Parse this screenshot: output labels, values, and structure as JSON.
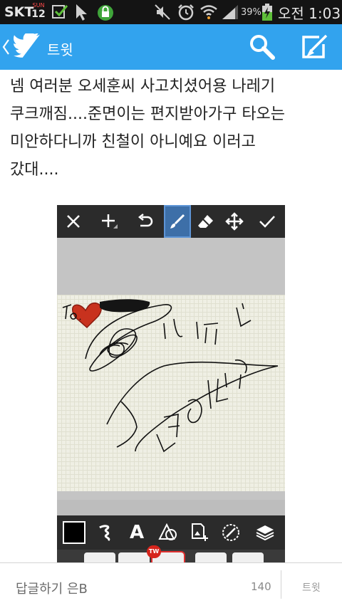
{
  "status_bar": {
    "carrier": "SKT",
    "calendar_day": "SUN",
    "calendar_date": "12",
    "battery_percent": "39%",
    "time": "오전 1:03"
  },
  "app_bar": {
    "title": "트윗",
    "color": "#32a3ee"
  },
  "tweet": {
    "lines": [
      "넴 여러분 오세훈씨 사고치셨어용 나레기",
      "쿠크깨짐....준면이는 편지받아가구 타오는",
      "미안하다니까 친철이 아니예요 이러고",
      "갔대...."
    ]
  },
  "photo": {
    "handwriting": "To. 세훈 김준면",
    "badge": "TW",
    "toolbar_icons": [
      "close-icon",
      "add-icon",
      "undo-icon",
      "brush-icon",
      "eraser-icon",
      "move-icon",
      "check-icon"
    ],
    "bottom_icons": [
      "color-swatch-icon",
      "stroke-icon",
      "text-icon",
      "shapes-icon",
      "add-image-icon",
      "pen-settings-icon",
      "layers-icon"
    ]
  },
  "reply": {
    "placeholder": "답글하기 은B",
    "count": "140",
    "send_label": "트윗"
  }
}
